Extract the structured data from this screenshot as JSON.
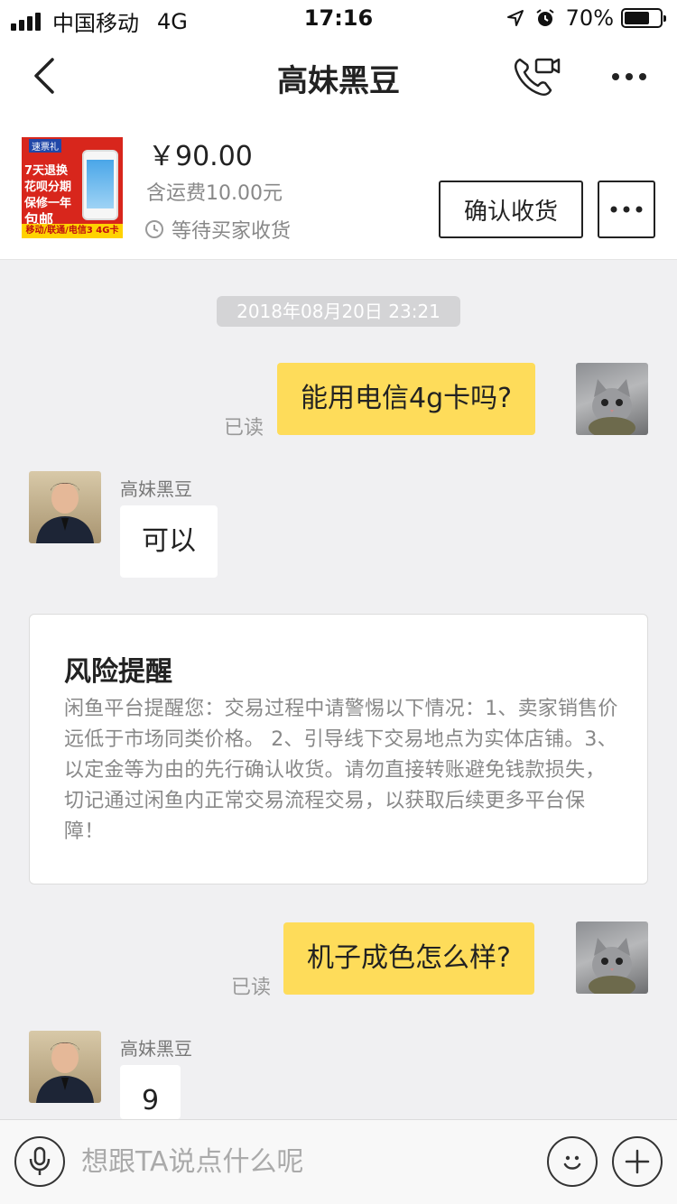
{
  "status_bar": {
    "carrier": "中国移动",
    "network": "4G",
    "time": "17:16",
    "battery_percent": "70%",
    "battery_level": 0.7
  },
  "nav": {
    "title": "高妹黑豆",
    "back_icon": "chevron-left-icon",
    "call_icon": "phone-video-icon",
    "more_icon": "ellipsis-icon"
  },
  "product": {
    "price": "￥90.00",
    "shipping": "含运费10.00元",
    "status": "等待买家收货",
    "confirm_label": "确认收货",
    "thumb": {
      "badge": "速票礼",
      "lines": [
        "7天退换",
        "花呗分期",
        "保修一年",
        "包邮"
      ],
      "bottom": "移动/联通/电信3 4G卡"
    }
  },
  "chat": {
    "timestamp": "2018年08月20日 23:21",
    "messages": [
      {
        "dir": "out",
        "text": "能用电信4g卡吗?",
        "read": "已读"
      },
      {
        "dir": "in",
        "sender": "高妹黑豆",
        "text": "可以"
      },
      {
        "dir": "out",
        "text": "机子成色怎么样?",
        "read": "已读"
      },
      {
        "dir": "in",
        "sender": "高妹黑豆",
        "text": "9"
      }
    ],
    "risk": {
      "title": "风险提醒",
      "body": "闲鱼平台提醒您：交易过程中请警惕以下情况：1、卖家销售价远低于市场同类价格。 2、引导线下交易地点为实体店铺。3、以定金等为由的先行确认收货。请勿直接转账避免钱款损失，切记通过闲鱼内正常交易流程交易，以获取后续更多平台保障！"
    }
  },
  "input_bar": {
    "placeholder": "想跟TA说点什么呢",
    "mic_icon": "microphone-icon",
    "emoji_icon": "smile-icon",
    "add_icon": "plus-icon"
  },
  "colors": {
    "bubble_out": "#fedc5a",
    "bubble_in": "#ffffff",
    "background": "#f0f0f2"
  }
}
